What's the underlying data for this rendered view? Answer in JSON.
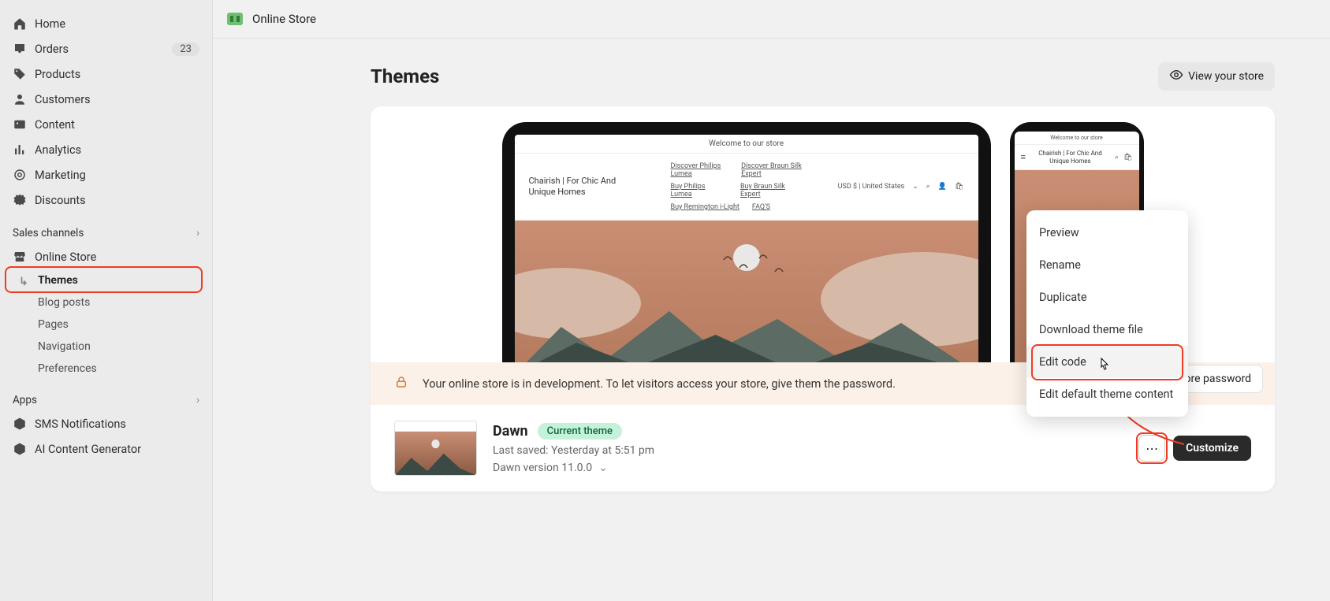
{
  "sidebar": {
    "items": [
      {
        "label": "Home"
      },
      {
        "label": "Orders",
        "badge": "23"
      },
      {
        "label": "Products"
      },
      {
        "label": "Customers"
      },
      {
        "label": "Content"
      },
      {
        "label": "Analytics"
      },
      {
        "label": "Marketing"
      },
      {
        "label": "Discounts"
      }
    ],
    "sales_channels_heading": "Sales channels",
    "online_store_label": "Online Store",
    "online_store_sub": [
      {
        "label": "Themes"
      },
      {
        "label": "Blog posts"
      },
      {
        "label": "Pages"
      },
      {
        "label": "Navigation"
      },
      {
        "label": "Preferences"
      }
    ],
    "apps_heading": "Apps",
    "apps": [
      {
        "label": "SMS Notifications"
      },
      {
        "label": "AI Content Generator"
      }
    ]
  },
  "topbar": {
    "title": "Online Store"
  },
  "page": {
    "title": "Themes",
    "view_store_label": "View your store"
  },
  "preview": {
    "announcement": "Welcome to our store",
    "shop_name": "Chairish | For Chic And Unique Homes",
    "menu_row1": [
      "Discover Philips Lumea",
      "Discover Braun Silk Expert"
    ],
    "menu_row2": [
      "Buy Philips Lumea",
      "Buy Braun Silk Expert"
    ],
    "menu_row3": [
      "Buy Remington i-Light",
      "FAQ'S"
    ],
    "currency": "USD $ | United States"
  },
  "dev_banner": {
    "text": "Your online store is in development. To let visitors access your store, give them the password.",
    "store_password_label": "store password"
  },
  "theme": {
    "name": "Dawn",
    "current_badge": "Current theme",
    "last_saved": "Last saved: Yesterday at 5:51 pm",
    "version": "Dawn version 11.0.0",
    "customize_label": "Customize"
  },
  "dropdown": {
    "items": [
      "Preview",
      "Rename",
      "Duplicate",
      "Download theme file",
      "Edit code",
      "Edit default theme content"
    ],
    "hovered": "Edit code"
  }
}
